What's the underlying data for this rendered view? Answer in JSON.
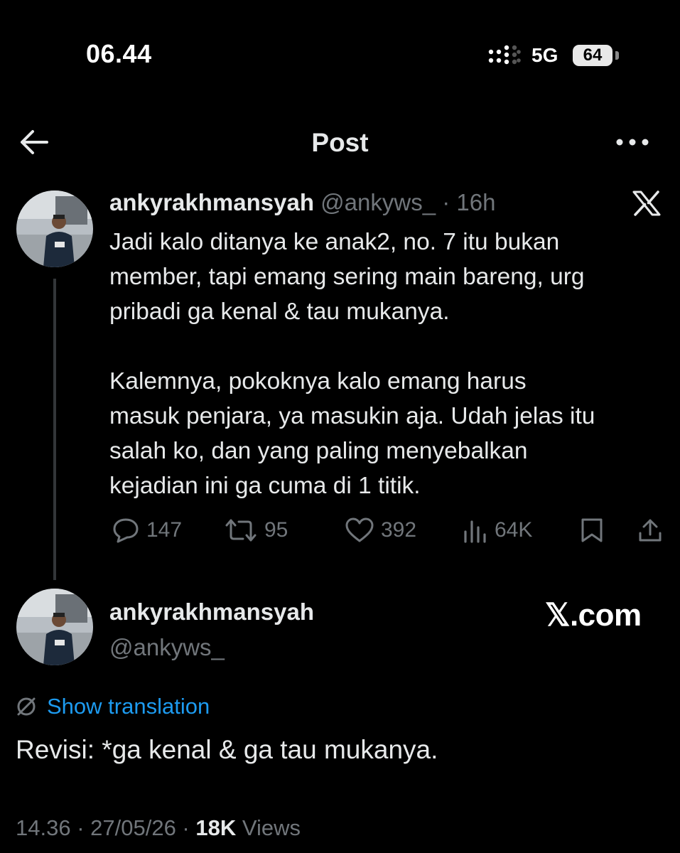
{
  "status_bar": {
    "time": "06.44",
    "network": "5G",
    "battery": "64"
  },
  "header": {
    "title": "Post",
    "back_icon": "arrow-left-icon",
    "more_icon": "more-horizontal-icon"
  },
  "tweet": {
    "display_name": "ankyrakhmansyah",
    "handle": "@ankyws_",
    "separator": " · ",
    "time_ago": "16h",
    "text": "Jadi kalo ditanya ke anak2, no. 7 itu bukan\nmember, tapi emang sering main bareng, urg\npribadi ga kenal & tau mukanya.\n\nKalemnya, pokoknya kalo emang harus\nmasuk penjara, ya masukin aja. Udah jelas itu\nsalah ko, dan yang paling menyebalkan\nkejadian ini ga cuma di 1 titik.",
    "replies": "147",
    "reposts": "95",
    "likes": "392",
    "views": "64K"
  },
  "reply": {
    "display_name": "ankyrakhmansyah",
    "handle": "@ankyws_",
    "watermark": "𝕏.com",
    "show_translation": "Show translation",
    "text": "Revisi: *ga kenal & ga tau mukanya.",
    "time": "14.36",
    "date": "27/05/26",
    "sep": " · ",
    "views_count": "18K",
    "views_label": " Views"
  },
  "colors": {
    "background": "#000000",
    "text": "#e7e9ea",
    "muted": "#71767b",
    "link": "#1d9bf0",
    "thread_line": "#333639"
  }
}
